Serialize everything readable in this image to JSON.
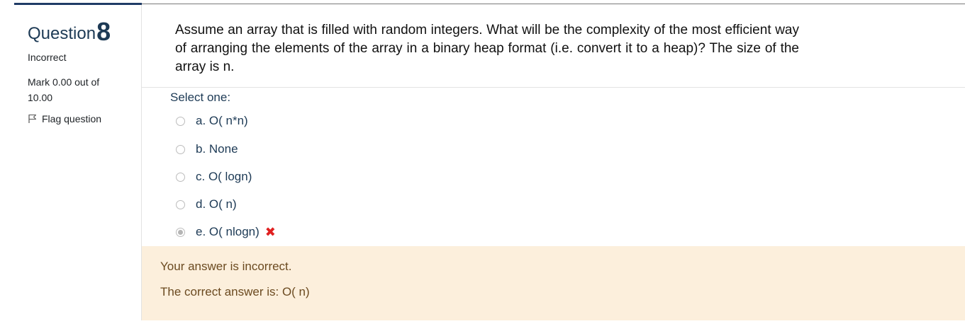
{
  "question": {
    "label": "Question",
    "number": "8",
    "state": "Incorrect",
    "grade": "Mark 0.00 out of 10.00",
    "flag_label": "Flag question",
    "text": "Assume an array that is filled with random integers. What will be the complexity of the most efficient way of arranging the elements of the array in a binary heap format (i.e. convert it to a heap)? The size of the array is n.",
    "prompt": "Select one:",
    "options": [
      {
        "label": "a. O( n*n)",
        "selected": false
      },
      {
        "label": "b. None",
        "selected": false
      },
      {
        "label": "c. O( logn)",
        "selected": false
      },
      {
        "label": "d. O( n)",
        "selected": false
      },
      {
        "label": "e. O( nlogn)",
        "selected": true,
        "mark": "✖"
      }
    ]
  },
  "feedback": {
    "result": "Your answer is incorrect.",
    "correct_answer": "The correct answer is: O( n)"
  },
  "colors": {
    "heading": "#1d3a55",
    "feedback_bg": "#fcefdc",
    "feedback_text": "#6b4a20",
    "wrong_mark": "#e02020"
  },
  "icons": {
    "flag": "flag-icon",
    "wrong": "cross-icon"
  }
}
